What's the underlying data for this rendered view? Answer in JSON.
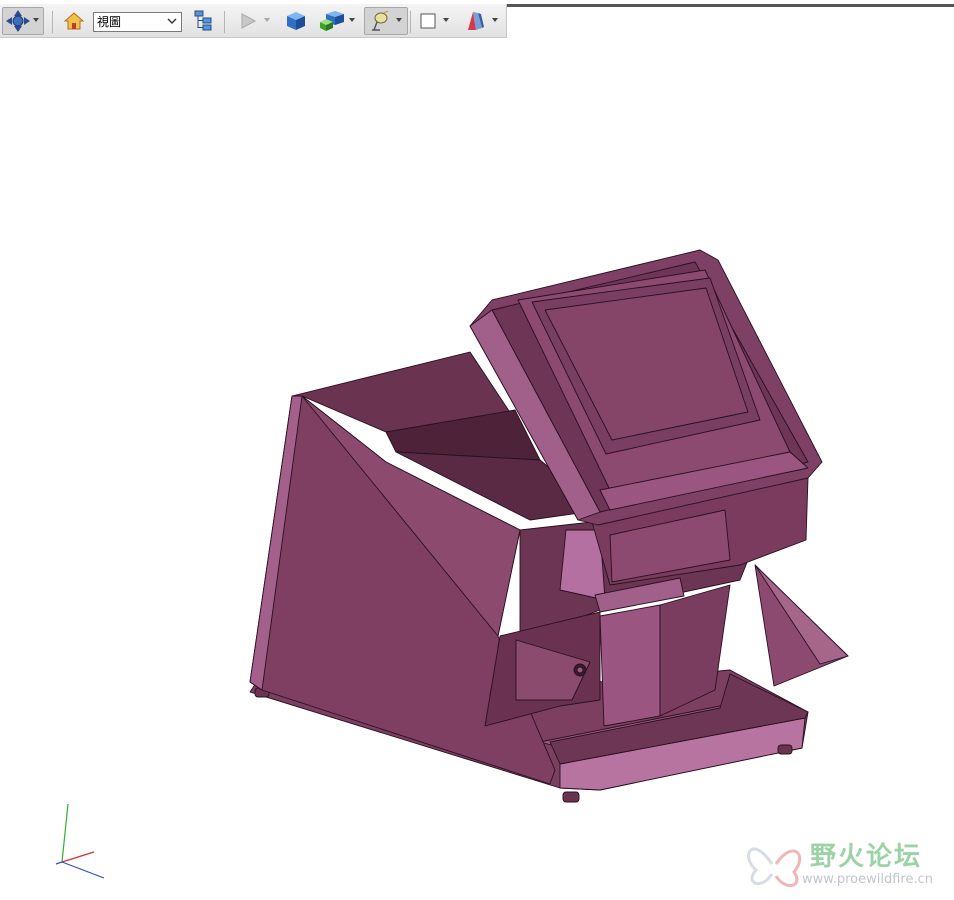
{
  "toolbar": {
    "view_select_value": "視圖"
  },
  "icons": {
    "orient": "move-orient-icon",
    "home": "home-icon",
    "tree": "model-tree-icon",
    "play": "play-icon",
    "cube_blue": "shaded-cube-icon",
    "cube_pair": "assembly-cubes-icon",
    "light": "lamp-icon",
    "square": "display-square-icon",
    "appearance": "appearance-icon"
  },
  "colors": {
    "model": "#8a4a6c",
    "model_dark": "#5e2f48",
    "model_light": "#a5668a",
    "axis_x": "#d03030",
    "axis_y": "#30b030",
    "axis_z": "#3050d0"
  },
  "watermark": {
    "title": "野火论坛",
    "url": "www.proewildfire.cn"
  }
}
